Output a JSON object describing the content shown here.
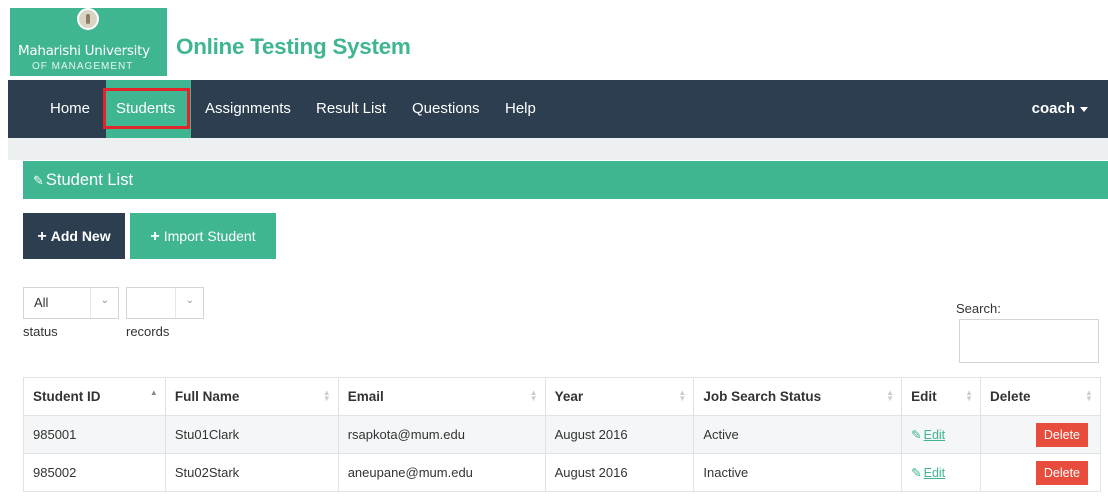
{
  "brand": {
    "university_line1": "Maharishi University",
    "university_line2": "OF MANAGEMENT",
    "app_title": "Online Testing System",
    "accent_color": "#3fb592",
    "nav_color": "#2c3e50"
  },
  "nav": {
    "items": [
      {
        "label": "Home"
      },
      {
        "label": "Students",
        "active": true
      },
      {
        "label": "Assignments"
      },
      {
        "label": "Result List"
      },
      {
        "label": "Questions"
      },
      {
        "label": "Help"
      }
    ],
    "user": "coach"
  },
  "panel": {
    "heading": "Student List",
    "heading_icon": "edit-icon"
  },
  "actions": {
    "add_new": "Add New",
    "import_student": "Import Student"
  },
  "filters": {
    "status": {
      "value": "All",
      "label": "status"
    },
    "records": {
      "value": "",
      "label": "records"
    },
    "search_label": "Search:",
    "search_value": ""
  },
  "table": {
    "columns": [
      "Student ID",
      "Full Name",
      "Email",
      "Year",
      "Job Search Status",
      "Edit",
      "Delete"
    ],
    "sorted_column": "Student ID",
    "sort_direction": "ascending",
    "rows": [
      {
        "id": "985001",
        "name": "Stu01Clark",
        "email": "rsapkota@mum.edu",
        "year": "August 2016",
        "status": "Active",
        "edit": "Edit",
        "delete": "Delete"
      },
      {
        "id": "985002",
        "name": "Stu02Stark",
        "email": "aneupane@mum.edu",
        "year": "August 2016",
        "status": "Inactive",
        "edit": "Edit",
        "delete": "Delete"
      }
    ]
  },
  "colors": {
    "delete": "#e74c3c",
    "highlight_border": "#e0252b"
  }
}
